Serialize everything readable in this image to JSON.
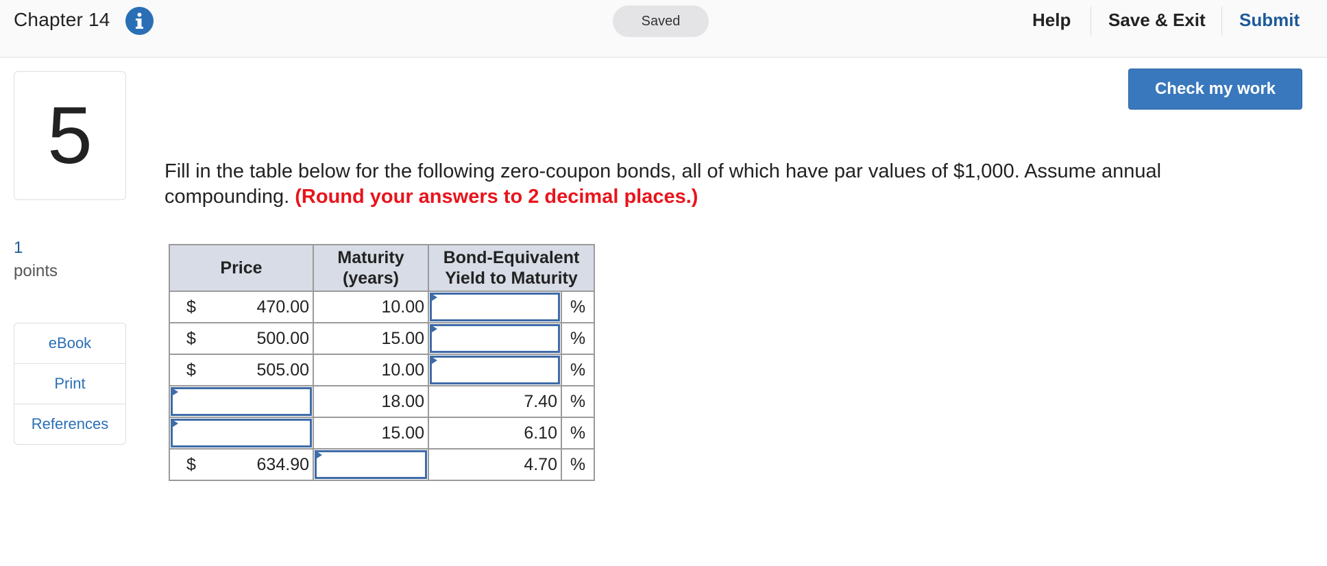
{
  "header": {
    "chapter_title": "Chapter 14",
    "info_icon": "info-icon",
    "saved_label": "Saved",
    "nav": {
      "help": "Help",
      "save_exit": "Save & Exit",
      "submit": "Submit"
    }
  },
  "question": {
    "number": "5",
    "points_value": "1",
    "points_label": "points",
    "check_button": "Check my work",
    "prompt_text": "Fill in the table below for the following zero-coupon bonds, all of which have par values of $1,000. Assume annual compounding.",
    "prompt_emphasis": "(Round your answers to 2 decimal places.)"
  },
  "side_menu": {
    "ebook": "eBook",
    "print": "Print",
    "references": "References"
  },
  "table": {
    "headers": {
      "price": "Price",
      "maturity_line1": "Maturity",
      "maturity_line2": "(years)",
      "yield_line1": "Bond-Equivalent",
      "yield_line2": "Yield to Maturity"
    },
    "rows": [
      {
        "dollar": "$",
        "price": "470.00",
        "maturity": "10.00",
        "yield": "",
        "percent": "%"
      },
      {
        "dollar": "$",
        "price": "500.00",
        "maturity": "15.00",
        "yield": "",
        "percent": "%"
      },
      {
        "dollar": "$",
        "price": "505.00",
        "maturity": "10.00",
        "yield": "",
        "percent": "%"
      },
      {
        "dollar": "",
        "price": "",
        "maturity": "18.00",
        "yield": "7.40",
        "percent": "%"
      },
      {
        "dollar": "",
        "price": "",
        "maturity": "15.00",
        "yield": "6.10",
        "percent": "%"
      },
      {
        "dollar": "$",
        "price": "634.90",
        "maturity": "",
        "yield": "4.70",
        "percent": "%"
      }
    ]
  },
  "colors": {
    "accent": "#3a78bd",
    "link": "#2a6fb5",
    "submit": "#1d5a99",
    "emphasis": "#e8141c",
    "table_header": "#d7dce6",
    "input_border": "#3e6ba8"
  }
}
